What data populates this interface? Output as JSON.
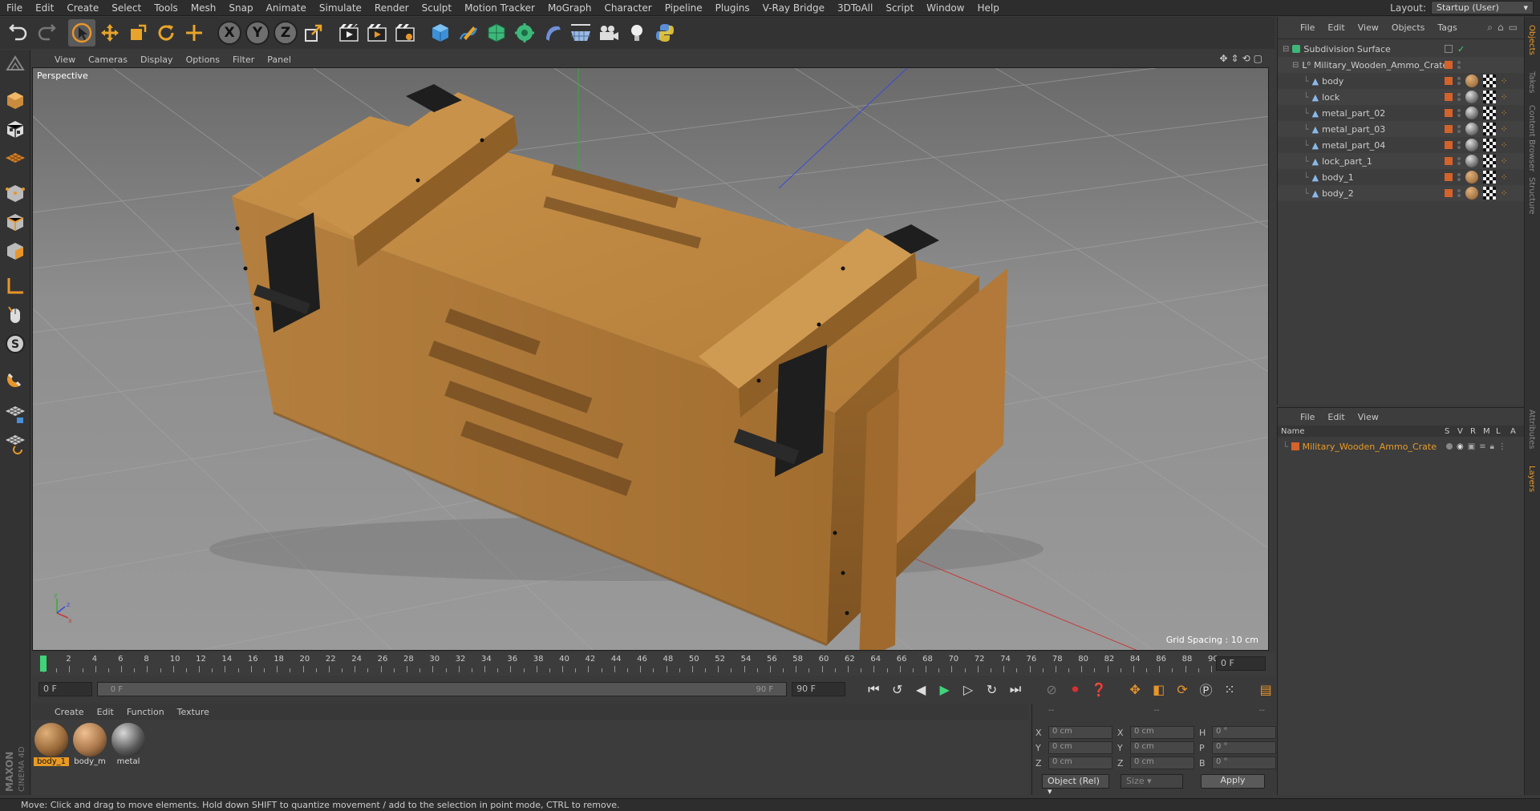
{
  "menubar": {
    "items": [
      "File",
      "Edit",
      "Create",
      "Select",
      "Tools",
      "Mesh",
      "Snap",
      "Animate",
      "Simulate",
      "Render",
      "Sculpt",
      "Motion Tracker",
      "MoGraph",
      "Character",
      "Pipeline",
      "Plugins",
      "V-Ray Bridge",
      "3DToAll",
      "Script",
      "Window",
      "Help"
    ],
    "layout_label": "Layout:",
    "layout_value": "Startup (User)"
  },
  "toolbar": {
    "axis_x": "X",
    "axis_y": "Y",
    "axis_z": "Z",
    "icons": [
      "undo-icon",
      "redo-icon",
      "select-arrow-icon",
      "move-icon",
      "scale-icon",
      "rotate-icon",
      "live-select-icon",
      "x-axis-lock",
      "y-axis-lock",
      "z-axis-lock",
      "world-coord-icon",
      "render-view-icon",
      "render-picture-viewer-icon",
      "edit-render-settings-icon",
      "cube-icon",
      "pen-icon",
      "subdivision-icon",
      "cloner-icon",
      "deformer-icon",
      "floor-icon",
      "camera-icon",
      "light-icon",
      "python-icon"
    ]
  },
  "viewport": {
    "menu": [
      "View",
      "Cameras",
      "Display",
      "Options",
      "Filter",
      "Panel"
    ],
    "label": "Perspective",
    "grid_spacing": "Grid Spacing : 10 cm"
  },
  "timeline": {
    "ticks": [
      "0",
      "2",
      "4",
      "6",
      "8",
      "10",
      "12",
      "14",
      "16",
      "18",
      "20",
      "22",
      "24",
      "26",
      "28",
      "30",
      "32",
      "34",
      "36",
      "38",
      "40",
      "42",
      "44",
      "46",
      "48",
      "50",
      "52",
      "54",
      "56",
      "58",
      "60",
      "62",
      "64",
      "66",
      "68",
      "70",
      "72",
      "74",
      "76",
      "78",
      "80",
      "82",
      "84",
      "86",
      "88",
      "90"
    ],
    "current_frame_display": "0 F",
    "start_field": "0 F",
    "range_start": "0 F",
    "range_end": "90 F",
    "end_field": "90 F"
  },
  "material_manager": {
    "menu": [
      "Create",
      "Edit",
      "Function",
      "Texture"
    ],
    "materials": [
      {
        "name": "body_1",
        "color": "#9a6a3a",
        "active": true
      },
      {
        "name": "body_m",
        "color": "#a8764a",
        "active": false
      },
      {
        "name": "metal",
        "color": "#5a5a5a",
        "active": false
      }
    ]
  },
  "coordinates": {
    "header": [
      "--",
      "--",
      "--"
    ],
    "rows": [
      {
        "l1": "X",
        "v1": "0 cm",
        "l2": "X",
        "v2": "0 cm",
        "l3": "H",
        "v3": "0 °"
      },
      {
        "l1": "Y",
        "v1": "0 cm",
        "l2": "Y",
        "v2": "0 cm",
        "l3": "P",
        "v3": "0 °"
      },
      {
        "l1": "Z",
        "v1": "0 cm",
        "l2": "Z",
        "v2": "0 cm",
        "l3": "B",
        "v3": "0 °"
      }
    ],
    "mode": "Object (Rel)",
    "size": "Size",
    "apply": "Apply"
  },
  "object_manager": {
    "menu": [
      "File",
      "Edit",
      "View",
      "Objects",
      "Tags"
    ],
    "root": "Subdivision Surface",
    "group": "Military_Wooden_Ammo_Crate",
    "children": [
      "body",
      "lock",
      "metal_part_02",
      "metal_part_03",
      "metal_part_04",
      "lock_part_1",
      "body_1",
      "body_2"
    ]
  },
  "layer_manager": {
    "menu": [
      "File",
      "Edit",
      "View"
    ],
    "columns": [
      "Name",
      "S",
      "V",
      "R",
      "M",
      "L",
      "A"
    ],
    "layers": [
      "Military_Wooden_Ammo_Crate"
    ],
    "layer_color": "#d4622a"
  },
  "side_tabs": [
    "Objects",
    "Takes",
    "Content Browser",
    "Structure",
    "Attributes",
    "Layers"
  ],
  "status_text": "Move: Click and drag to move elements. Hold down SHIFT to quantize movement / add to the selection in point mode, CTRL to remove.",
  "brand": "MAXON CINEMA 4D"
}
